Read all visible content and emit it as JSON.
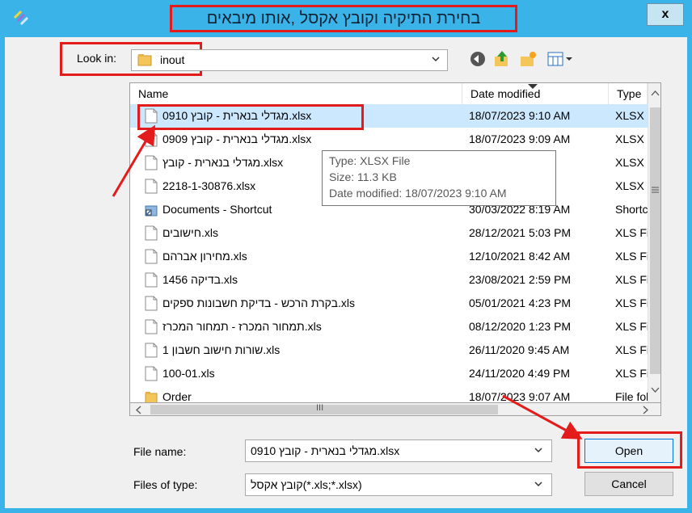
{
  "window": {
    "title": "בחירת התיקיה וקובץ אקסל ,אותו מיבאים",
    "close_label": "x"
  },
  "lookin": {
    "label": "Look in:",
    "value": "inout"
  },
  "columns": {
    "name": "Name",
    "date": "Date modified",
    "type": "Type"
  },
  "files": [
    {
      "name": "0910 מגדלי בנארית - קובץ.xlsx",
      "date": "18/07/2023 9:10 AM",
      "type": "XLSX F",
      "icon": "file-icon",
      "selected": true
    },
    {
      "name": "0909 מגדלי בנארית - קובץ.xlsx",
      "date": "18/07/2023 9:09 AM",
      "type": "XLSX F",
      "icon": "file-icon"
    },
    {
      "name": "מגדלי בנארית - קובץ.xlsx",
      "date": "8 PM",
      "type": "XLSX F",
      "icon": "file-icon"
    },
    {
      "name": "2218-1-30876.xlsx",
      "date": "4 PM",
      "type": "XLSX F",
      "icon": "file-icon"
    },
    {
      "name": "Documents - Shortcut",
      "date": "30/03/2022 8:19 AM",
      "type": "Shortc",
      "icon": "shortcut-folder-icon"
    },
    {
      "name": "חישובים.xls",
      "date": "28/12/2021 5:03 PM",
      "type": "XLS Fil",
      "icon": "file-icon"
    },
    {
      "name": "מחירון אברהם.xls",
      "date": "12/10/2021 8:42 AM",
      "type": "XLS Fil",
      "icon": "file-icon"
    },
    {
      "name": "1456 בדיקה.xls",
      "date": "23/08/2021 2:59 PM",
      "type": "XLS Fil",
      "icon": "file-icon"
    },
    {
      "name": "בקרת הרכש - בדיקת חשבונות ספקים.xls",
      "date": "05/01/2021 4:23 PM",
      "type": "XLS Fil",
      "icon": "file-icon"
    },
    {
      "name": "תמחור המכרז - תמחור המכרז.xls",
      "date": "08/12/2020 1:23 PM",
      "type": "XLS Fil",
      "icon": "file-icon"
    },
    {
      "name": "שורות חישוב חשבון 1.xls",
      "date": "26/11/2020 9:45 AM",
      "type": "XLS Fil",
      "icon": "file-icon"
    },
    {
      "name": "100-01.xls",
      "date": "24/11/2020 4:49 PM",
      "type": "XLS Fil",
      "icon": "file-icon"
    },
    {
      "name": "Order",
      "date": "18/07/2023 9:07 AM",
      "type": "File fol",
      "icon": "folder-icon"
    }
  ],
  "tooltip": {
    "line1": "Type: XLSX File",
    "line2": "Size: 11.3 KB",
    "line3": "Date modified: 18/07/2023 9:10 AM"
  },
  "scroll": {
    "hgrip": "III"
  },
  "filename": {
    "label": "File name:",
    "value": "0910 מגדלי בנארית - קובץ.xlsx"
  },
  "filetype": {
    "label": "Files of type:",
    "value": "קובץ אקסל(*.xls;*.xlsx)"
  },
  "buttons": {
    "open": "Open",
    "cancel": "Cancel"
  },
  "colors": {
    "accent": "#3ab4e8",
    "highlight": "#e31b1b",
    "selection": "#cce8ff"
  }
}
